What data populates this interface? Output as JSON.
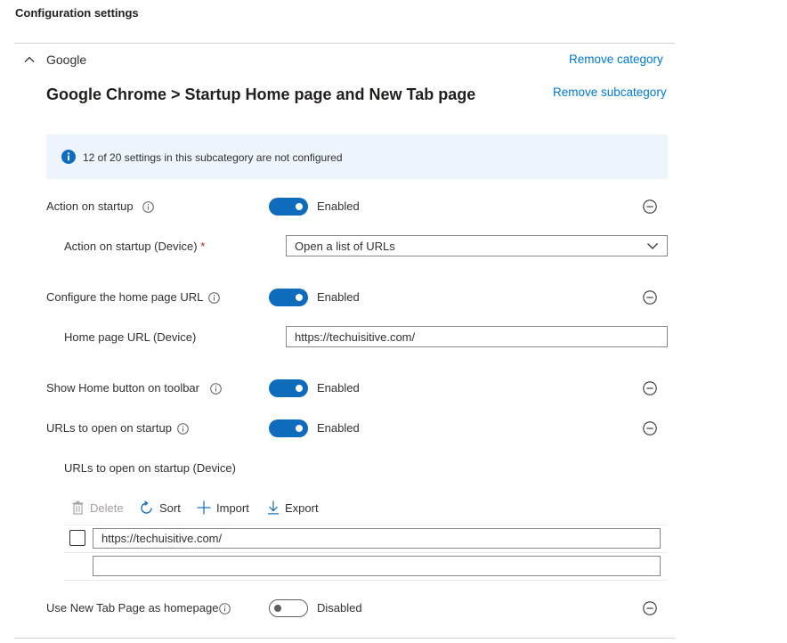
{
  "page": {
    "title": "Configuration settings"
  },
  "category": {
    "name": "Google",
    "remove_label": "Remove category"
  },
  "subcategory": {
    "title": "Google Chrome > Startup Home page and New Tab page",
    "remove_label": "Remove subcategory"
  },
  "banner": {
    "text": "12 of 20 settings in this subcategory are not configured"
  },
  "settings": {
    "action_on_startup": {
      "label": "Action on startup",
      "state": "Enabled"
    },
    "action_on_startup_device": {
      "label": "Action on startup (Device)",
      "required_mark": "*",
      "value": "Open a list of URLs"
    },
    "home_page_url": {
      "label": "Configure the home page URL",
      "state": "Enabled"
    },
    "home_page_url_device": {
      "label": "Home page URL (Device)",
      "value": "https://techuisitive.com/"
    },
    "show_home_button": {
      "label": "Show Home button on toolbar",
      "state": "Enabled"
    },
    "urls_on_startup": {
      "label": "URLs to open on startup",
      "state": "Enabled"
    },
    "urls_on_startup_device": {
      "label": "URLs to open on startup (Device)"
    },
    "use_new_tab_page": {
      "label": "Use New Tab Page as homepage",
      "state": "Disabled"
    }
  },
  "url_list": {
    "toolbar": {
      "delete": "Delete",
      "sort": "Sort",
      "import": "Import",
      "export": "Export"
    },
    "rows": [
      {
        "value": "https://techuisitive.com/"
      },
      {
        "value": ""
      }
    ]
  },
  "colors": {
    "accent": "#0f6cbd",
    "link": "#0078d4",
    "banner_bg": "#eef4fc",
    "required": "#a4262c"
  }
}
